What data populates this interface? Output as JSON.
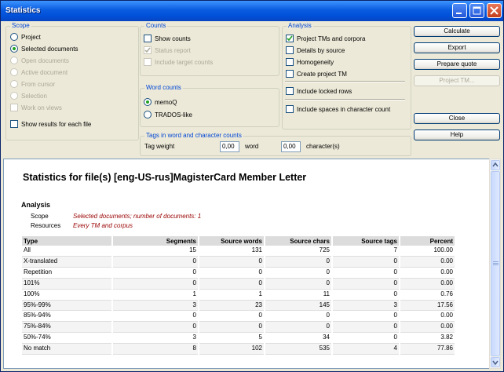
{
  "window": {
    "title": "Statistics"
  },
  "scope": {
    "label": "Scope",
    "options": [
      {
        "label": "Project"
      },
      {
        "label": "Selected documents"
      },
      {
        "label": "Open documents"
      },
      {
        "label": "Active document"
      },
      {
        "label": "From cursor"
      },
      {
        "label": "Selection"
      }
    ],
    "work_on_views": "Work on views",
    "show_results": "Show results for each file"
  },
  "counts": {
    "label": "Counts",
    "show_counts": "Show counts",
    "status_report": "Status report",
    "include_target": "Include target counts"
  },
  "word_counts": {
    "label": "Word counts",
    "memoq": "memoQ",
    "trados": "TRADOS-like"
  },
  "tags": {
    "label": "Tags in word and character counts",
    "tag_weight": "Tag weight",
    "word_value": "0,00",
    "word_label": "word",
    "char_value": "0,00",
    "char_label": "character(s)"
  },
  "analysis": {
    "label": "Analysis",
    "project_tms": "Project TMs and corpora",
    "details_by_source": "Details by source",
    "homogeneity": "Homogeneity",
    "create_project_tm": "Create project TM",
    "include_locked": "Include locked rows",
    "include_spaces": "Include spaces in character count"
  },
  "buttons": {
    "calculate": "Calculate",
    "export": "Export",
    "prepare_quote": "Prepare quote",
    "project_tm": "Project TM...",
    "close": "Close",
    "help": "Help"
  },
  "report": {
    "heading": "Statistics for file(s) [eng-US-rus]MagisterCard Member Letter",
    "section": "Analysis",
    "scope_key": "Scope",
    "scope_value": "Selected documents; number of documents: 1",
    "resources_key": "Resources",
    "resources_value": "Every TM and corpus",
    "columns": [
      "Type",
      "Segments",
      "Source words",
      "Source chars",
      "Source tags",
      "Percent"
    ],
    "rows": [
      [
        "All",
        "15",
        "131",
        "725",
        "7",
        "100.00"
      ],
      [
        "X-translated",
        "0",
        "0",
        "0",
        "0",
        "0.00"
      ],
      [
        "Repetition",
        "0",
        "0",
        "0",
        "0",
        "0.00"
      ],
      [
        "101%",
        "0",
        "0",
        "0",
        "0",
        "0.00"
      ],
      [
        "100%",
        "1",
        "1",
        "11",
        "0",
        "0.76"
      ],
      [
        "95%-99%",
        "3",
        "23",
        "145",
        "3",
        "17.56"
      ],
      [
        "85%-94%",
        "0",
        "0",
        "0",
        "0",
        "0.00"
      ],
      [
        "75%-84%",
        "0",
        "0",
        "0",
        "0",
        "0.00"
      ],
      [
        "50%-74%",
        "3",
        "5",
        "34",
        "0",
        "3.82"
      ],
      [
        "No match",
        "8",
        "102",
        "535",
        "4",
        "77.86"
      ]
    ]
  }
}
